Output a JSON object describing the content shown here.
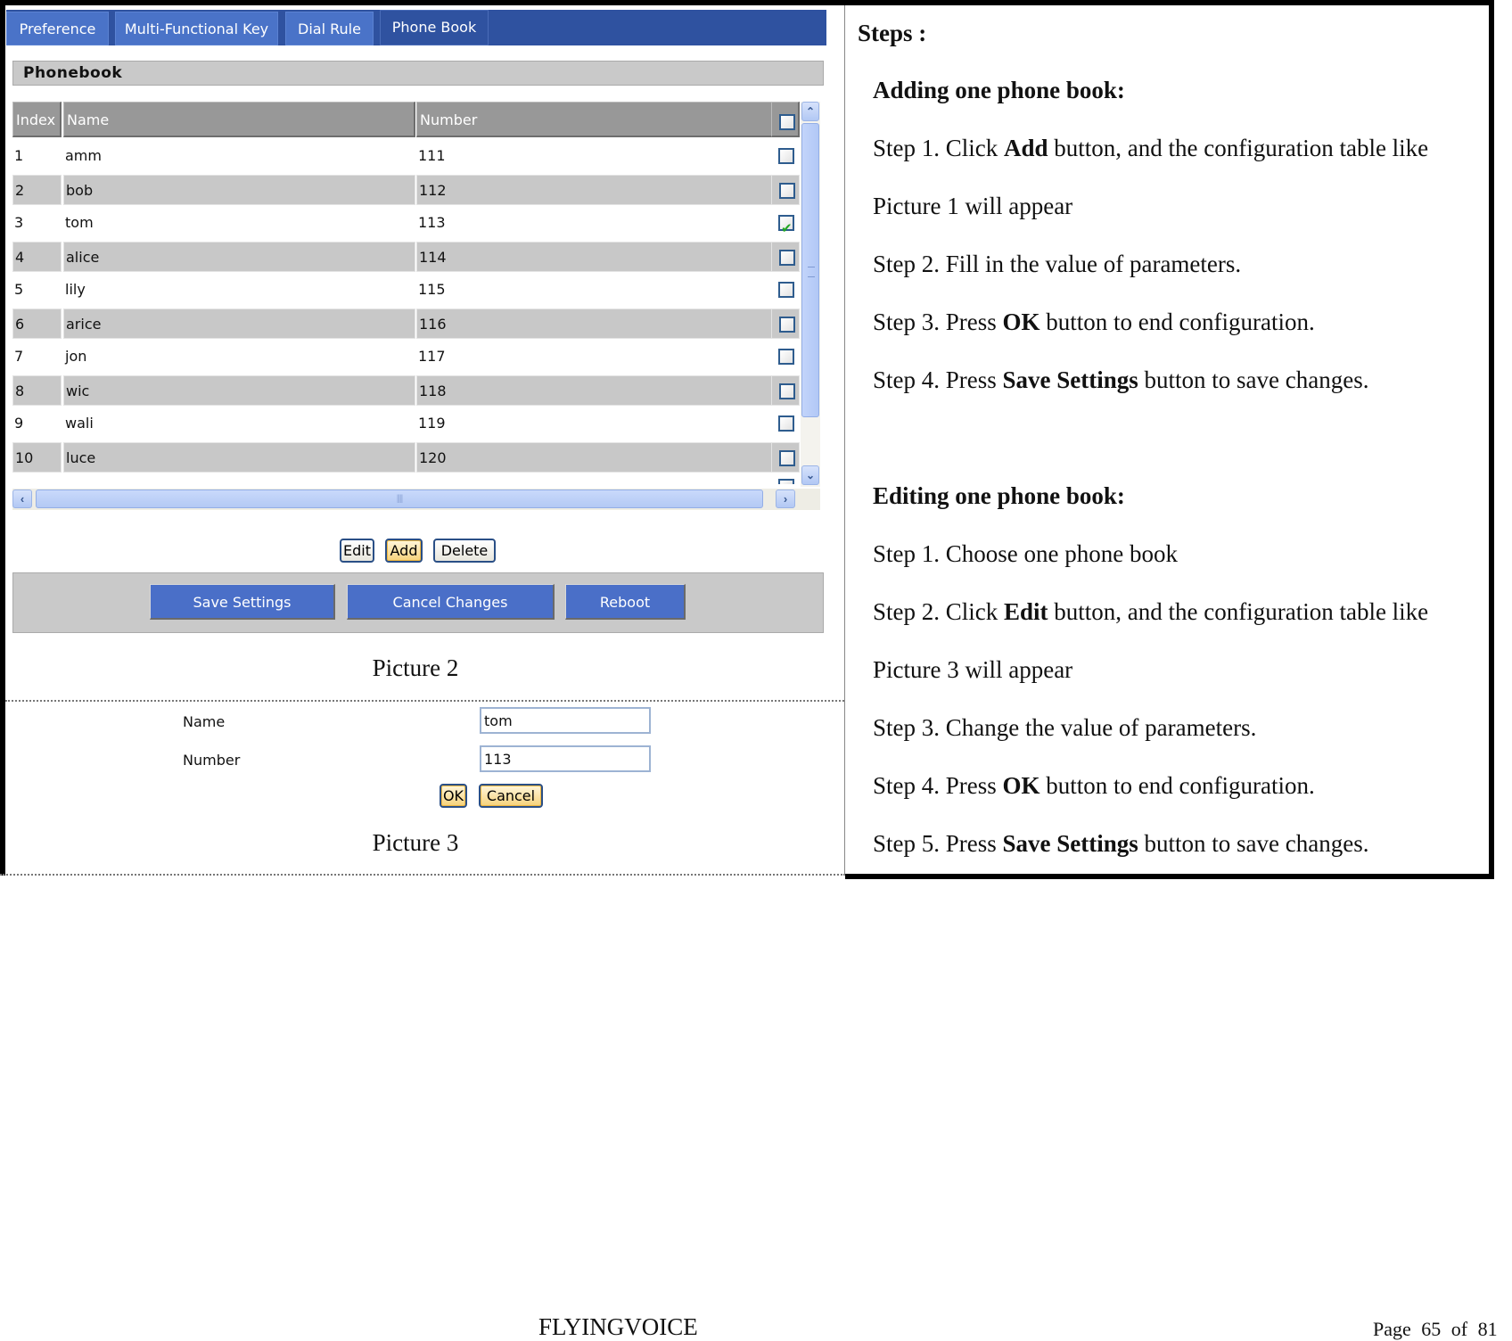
{
  "ui": {
    "tabs": [
      {
        "label": "Preference",
        "active": false
      },
      {
        "label": "Multi-Functional Key",
        "active": false
      },
      {
        "label": "Dial Rule",
        "active": false
      },
      {
        "label": "Phone Book",
        "active": true
      }
    ],
    "section_title": "Phonebook",
    "table": {
      "columns": [
        "Index",
        "Name",
        "Number"
      ],
      "rows": [
        {
          "index": "1",
          "name": "amm",
          "number": "111",
          "checked": false
        },
        {
          "index": "2",
          "name": "bob",
          "number": "112",
          "checked": false
        },
        {
          "index": "3",
          "name": "tom",
          "number": "113",
          "checked": true
        },
        {
          "index": "4",
          "name": "alice",
          "number": "114",
          "checked": false
        },
        {
          "index": "5",
          "name": "lily",
          "number": "115",
          "checked": false
        },
        {
          "index": "6",
          "name": "arice",
          "number": "116",
          "checked": false
        },
        {
          "index": "7",
          "name": "jon",
          "number": "117",
          "checked": false
        },
        {
          "index": "8",
          "name": "wic",
          "number": "118",
          "checked": false
        },
        {
          "index": "9",
          "name": "wali",
          "number": "119",
          "checked": false
        },
        {
          "index": "10",
          "name": "luce",
          "number": "120",
          "checked": false
        }
      ]
    },
    "row_buttons": {
      "edit": "Edit",
      "add": "Add",
      "delete": "Delete"
    },
    "action_buttons": {
      "save": "Save Settings",
      "cancel": "Cancel Changes",
      "reboot": "Reboot"
    },
    "caption_2": "Picture 2",
    "edit_form": {
      "name_label": "Name",
      "name_value": "tom",
      "number_label": "Number",
      "number_value": "113",
      "ok": "OK",
      "cancel": "Cancel"
    },
    "caption_3": "Picture 3",
    "colors": {
      "tab_bar": "#2f52a0",
      "tab": "#4a73c8",
      "action_button": "#4a6fc8",
      "header_gray": "#989898",
      "row_alt": "#c8c8c8"
    }
  },
  "steps": {
    "title": "Steps :",
    "adding": {
      "heading": "Adding one phone book:",
      "lines": [
        {
          "pre": "Step 1. Click ",
          "bold": "Add",
          "post": " button, and the configuration table like"
        },
        {
          "pre": "Picture 1 will appear",
          "bold": "",
          "post": ""
        },
        {
          "pre": "Step 2. Fill in the value of parameters.",
          "bold": "",
          "post": ""
        },
        {
          "pre": "Step 3. Press ",
          "bold": "OK",
          "post": " button to end configuration."
        },
        {
          "pre": "Step 4. Press ",
          "bold": "Save Settings",
          "post": " button to save changes."
        }
      ]
    },
    "editing": {
      "heading": "Editing one phone book:",
      "lines": [
        {
          "pre": "Step 1. Choose one phone book",
          "bold": "",
          "post": ""
        },
        {
          "pre": "Step 2. Click ",
          "bold": "Edit",
          "post": " button, and the configuration table like"
        },
        {
          "pre": "Picture 3 will appear",
          "bold": "",
          "post": ""
        },
        {
          "pre": "Step 3. Change the value of parameters.",
          "bold": "",
          "post": ""
        },
        {
          "pre": "Step 4. Press ",
          "bold": "OK",
          "post": " button to end configuration."
        },
        {
          "pre": "Step 5. Press ",
          "bold": "Save Settings",
          "post": " button to save changes."
        }
      ]
    }
  },
  "footer": {
    "brand": "FLYINGVOICE",
    "page": "Page 65 of 81"
  }
}
